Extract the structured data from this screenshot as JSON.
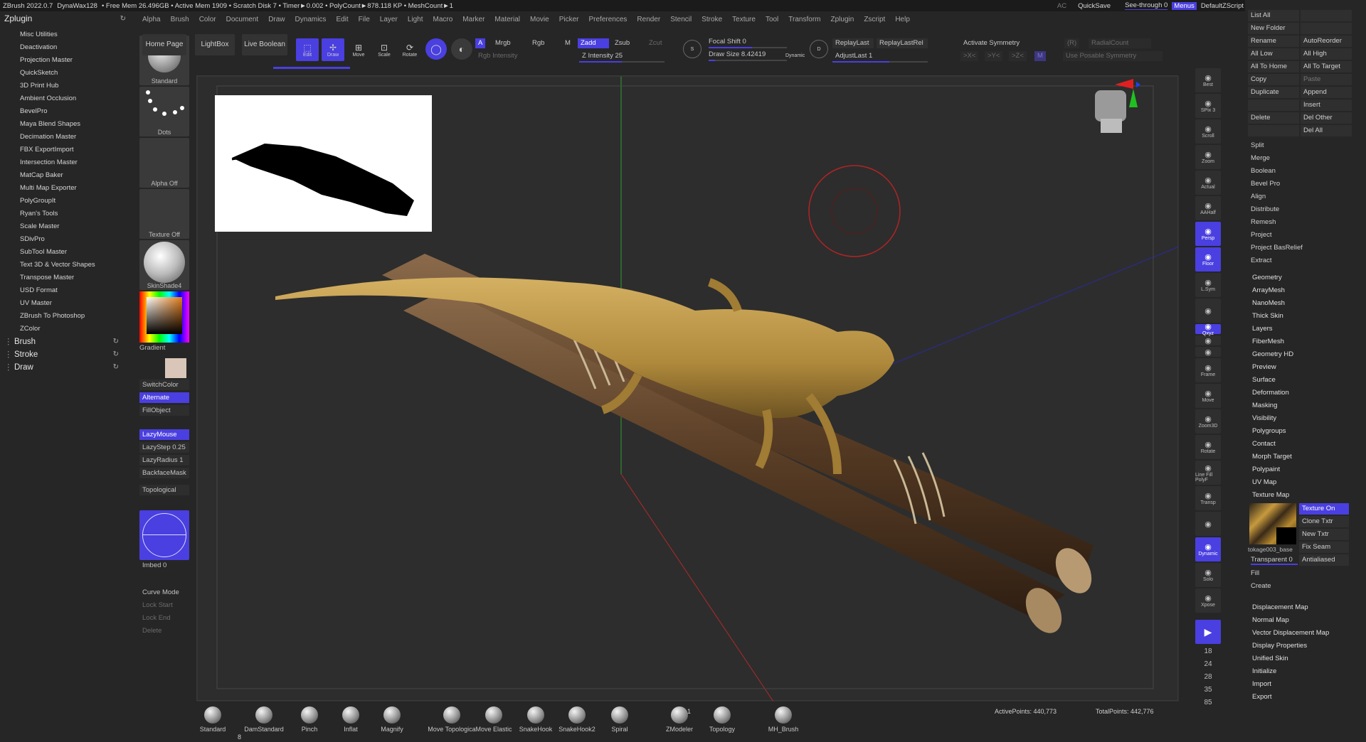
{
  "titlebar": {
    "app": "ZBrush 2022.0.7",
    "material": "DynaWax128",
    "status": "• Free Mem 26.496GB • Active Mem 1909 • Scratch Disk 7 • Timer►0.002 • PolyCount►878.118 KP • MeshCount►1",
    "ac": "AC",
    "quicksave": "QuickSave",
    "seethrough": "See-through",
    "seethrough_val": "0",
    "menus_btn": "Menus",
    "script": "DefaultZScript"
  },
  "menubar": [
    "Alpha",
    "Brush",
    "Color",
    "Document",
    "Draw",
    "Dynamics",
    "Edit",
    "File",
    "Layer",
    "Light",
    "Macro",
    "Marker",
    "Material",
    "Movie",
    "Picker",
    "Preferences",
    "Render",
    "Stencil",
    "Stroke",
    "Texture",
    "Tool",
    "Transform",
    "Zplugin",
    "Zscript",
    "Help"
  ],
  "leftpanel": {
    "title": "Zplugin",
    "items": [
      "Misc Utilities",
      "Deactivation",
      "Projection Master",
      "QuickSketch",
      "3D Print Hub",
      "Ambient Occlusion",
      "BevelPro",
      "Maya Blend Shapes",
      "Decimation Master",
      "FBX ExportImport",
      "Intersection Master",
      "MatCap Baker",
      "Multi Map Exporter",
      "PolyGroupIt",
      "Ryan's Tools",
      "Scale Master",
      "SDivPro",
      "SubTool Master",
      "Text 3D & Vector Shapes",
      "Transpose Master",
      "USD Format",
      "UV Master",
      "ZBrush To Photoshop",
      "ZColor"
    ],
    "groups": [
      "Brush",
      "Stroke",
      "Draw"
    ]
  },
  "shelf": {
    "brush": "Standard",
    "stroke": "Dots",
    "alpha": "Alpha Off",
    "texture": "Texture Off",
    "material": "SkinShade4",
    "gradient": "Gradient",
    "switch_color": "SwitchColor",
    "alternate": "Alternate",
    "fill_object": "FillObject",
    "lazy_mouse": "LazyMouse",
    "lazy_step": "LazyStep 0.25",
    "lazy_radius": "LazyRadius 1",
    "backface": "BackfaceMask",
    "topological": "Topological",
    "imbed": "Imbed 0",
    "curve_mode": "Curve Mode",
    "lock_start": "Lock Start",
    "lock_end": "Lock End",
    "delete": "Delete"
  },
  "toolbar": {
    "home": "Home Page",
    "lightbox": "LightBox",
    "live_boolean": "Live Boolean",
    "edit": "Edit",
    "draw": "Draw",
    "move": "Move",
    "scale": "Scale",
    "rotate": "Rotate",
    "a": "A",
    "mrgb": "Mrgb",
    "rgb": "Rgb",
    "m": "M",
    "rgb_intensity": "Rgb Intensity",
    "zadd": "Zadd",
    "zsub": "Zsub",
    "zcut": "Zcut",
    "z_intensity": "Z Intensity 25",
    "focal_shift": "Focal Shift 0",
    "draw_size": "Draw Size 8.42419",
    "dynamic": "Dynamic",
    "replay_last": "ReplayLast",
    "replay_last_rel": "ReplayLastRel",
    "adjust_last": "AdjustLast 1",
    "activate_symmetry": "Activate Symmetry",
    "r": "(R)",
    "radial_count": "RadialCount",
    "sym_x": ">X<",
    "sym_y": ">Y<",
    "sym_z": ">Z<",
    "sym_m": "M",
    "use_posable": "Use Posable Symmetry"
  },
  "righttools": [
    "Best",
    "SPix 3",
    "Scroll",
    "Zoom",
    "Actual",
    "AAHalf",
    "Persp",
    "Floor",
    "L.Sym",
    "",
    "Qxyz",
    "",
    "",
    "Frame",
    "Move",
    "Zoom3D",
    "Rotate",
    "Line Fill PolyF",
    "Transp",
    "",
    "Dynamic",
    "Solo",
    "Xpose"
  ],
  "rightnums": [
    "18",
    "24",
    "28",
    "35",
    "85"
  ],
  "rightpanel": {
    "grid1": [
      [
        "List All",
        ""
      ],
      [
        "New Folder",
        ""
      ],
      [
        "Rename",
        "AutoReorder"
      ],
      [
        "All Low",
        "All High"
      ],
      [
        "All To Home",
        "All To Target"
      ],
      [
        "Copy",
        "Paste"
      ],
      [
        "Duplicate",
        "Append"
      ],
      [
        "",
        "Insert"
      ],
      [
        "Delete",
        "Del Other"
      ],
      [
        "",
        "Del All"
      ]
    ],
    "subs": [
      "Split",
      "Merge",
      "Boolean",
      "Bevel Pro",
      "Align",
      "Distribute",
      "Remesh",
      "Project",
      "Project BasRelief",
      "Extract"
    ],
    "sections": [
      "Geometry",
      "ArrayMesh",
      "NanoMesh",
      "Thick Skin",
      "Layers",
      "FiberMesh",
      "Geometry HD",
      "Preview",
      "Surface",
      "Deformation",
      "Masking",
      "Visibility",
      "Polygroups",
      "Contact",
      "Morph Target",
      "Polypaint",
      "UV Map",
      "Texture Map"
    ],
    "texture_map": {
      "texture_on": "Texture On",
      "clone_txtr": "Clone Txtr",
      "new_txtr": "New Txtr",
      "fix_seam": "Fix Seam",
      "antialiased": "Antialiased",
      "name": "tokage003_base",
      "transparent": "Transparent 0",
      "fill": "Fill",
      "create": "Create"
    },
    "sections2": [
      "Displacement Map",
      "Normal Map",
      "Vector Displacement Map",
      "Display Properties",
      "Unified Skin",
      "Initialize",
      "Import",
      "Export"
    ]
  },
  "bottombar": {
    "brushes": [
      "Standard",
      "DamStandard",
      "Pinch",
      "Inflat",
      "Magnify",
      "Move Topologica",
      "Move Elastic",
      "SnakeHook",
      "SnakeHook2",
      "Spiral",
      "ZModeler",
      "Topology",
      "MH_Brush"
    ],
    "zmodeler_count": "1",
    "damstandard_count": "8",
    "active_points": "ActivePoints: 440,773",
    "total_points": "TotalPoints: 442,776"
  },
  "colors": {
    "accent": "#4a3fe0",
    "bg": "#262626",
    "viewport": "#2d2d2d"
  }
}
